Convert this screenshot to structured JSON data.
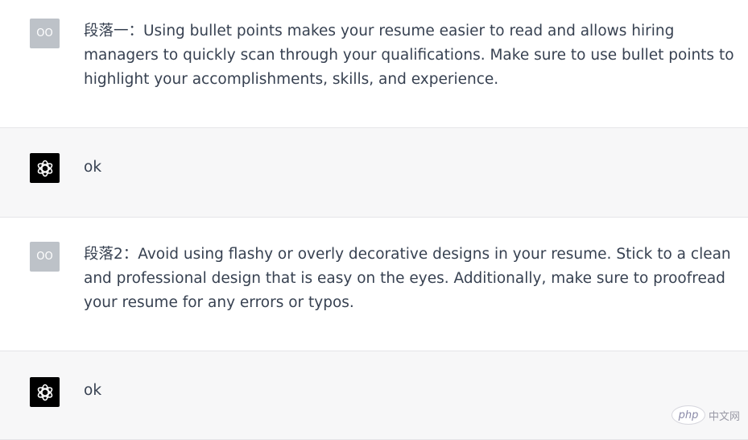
{
  "messages": [
    {
      "role": "user",
      "avatar_text": "OO",
      "text": "段落一：Using bullet points makes your resume easier to read and allows hiring managers to quickly scan through your qualifications. Make sure to use bullet points to highlight your accomplishments, skills, and experience."
    },
    {
      "role": "assistant",
      "avatar_icon": "openai-logo-icon",
      "text": "ok"
    },
    {
      "role": "user",
      "avatar_text": "OO",
      "text": "段落2：Avoid using flashy or overly decorative designs in your resume. Stick to a clean and professional design that is easy on the eyes. Additionally, make sure to proofread your resume for any errors or typos."
    },
    {
      "role": "assistant",
      "avatar_icon": "openai-logo-icon",
      "text": "ok"
    }
  ],
  "watermark": {
    "logo_text": "php",
    "site_text": "中文网"
  },
  "colors": {
    "user_bg": "#ffffff",
    "assistant_bg": "#f7f7f8",
    "user_avatar_bg": "#bdc2c8",
    "assistant_avatar_bg": "#000000",
    "text": "#374151"
  }
}
